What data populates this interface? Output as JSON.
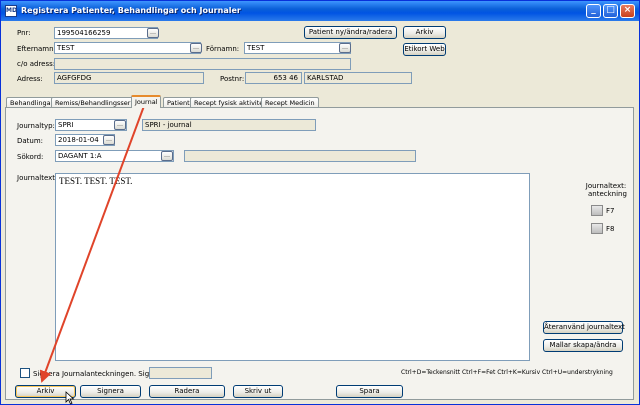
{
  "window": {
    "title": "Registrera Patienter, Behandlingar och Journaler",
    "app_icon": "MD",
    "controls": {
      "minimize": "_",
      "maximize": "□",
      "close": "×"
    }
  },
  "patient": {
    "pnr_label": "Pnr:",
    "pnr_value": "199504166259",
    "efternamn_label": "Efternamn:",
    "efternamn_value": "TEST",
    "fornamn_label": "Förnamn:",
    "fornamn_value": "TEST",
    "co_label": "c/o adress:",
    "co_value": "",
    "adress_label": "Adress:",
    "adress_value": "AGFGFDG",
    "postnr_label": "Postnr:",
    "postnr_value": "653 46",
    "ort_value": "KARLSTAD",
    "btn_patient": "Patient ny/ändra/radera",
    "btn_arkiv": "Arkiv",
    "btn_etikort": "Etikort Web"
  },
  "tabs": [
    {
      "label": "Behandlingar"
    },
    {
      "label": "Remiss/Behandlingsserie"
    },
    {
      "label": "Journal"
    },
    {
      "label": "Patient"
    },
    {
      "label": "Recept fysisk aktivitet"
    },
    {
      "label": "Recept Medicin"
    }
  ],
  "journal": {
    "typ_label": "Journaltyp:",
    "typ_value": "SPRI",
    "typ_desc": "SPRI - journal",
    "datum_label": "Datum:",
    "datum_value": "2018-01-04",
    "sokord_label": "Sökord:",
    "sokord_value": "DAGANT 1:A",
    "sokord_extra": "",
    "text_label": "Journaltext:",
    "text_value": "TEST. TEST. TEST.",
    "anteckning_label_1": "Journaltext:",
    "anteckning_label_2": "anteckning",
    "f7_label": "F7",
    "f8_label": "F8",
    "btn_ateranvand": "Återanvänd journaltext",
    "btn_mallar": "Mallar skapa/ändra",
    "sign_label": "Signera Journalanteckningen. Signum:",
    "signum_value": "",
    "shortcuts": "Ctrl+D=Teckensnitt Ctrl+F=Fet Ctrl+K=Kursiv Ctrl+U=understrykning"
  },
  "bottom_buttons": {
    "arkiv": "Arkiv",
    "signera": "Signera",
    "radera": "Radera",
    "skriv_ut": "Skriv ut",
    "spara": "Spara"
  },
  "colors": {
    "title_bar": "#0054e3",
    "window_bg": "#ece9d8",
    "annotation_arrow": "#e0442a"
  }
}
